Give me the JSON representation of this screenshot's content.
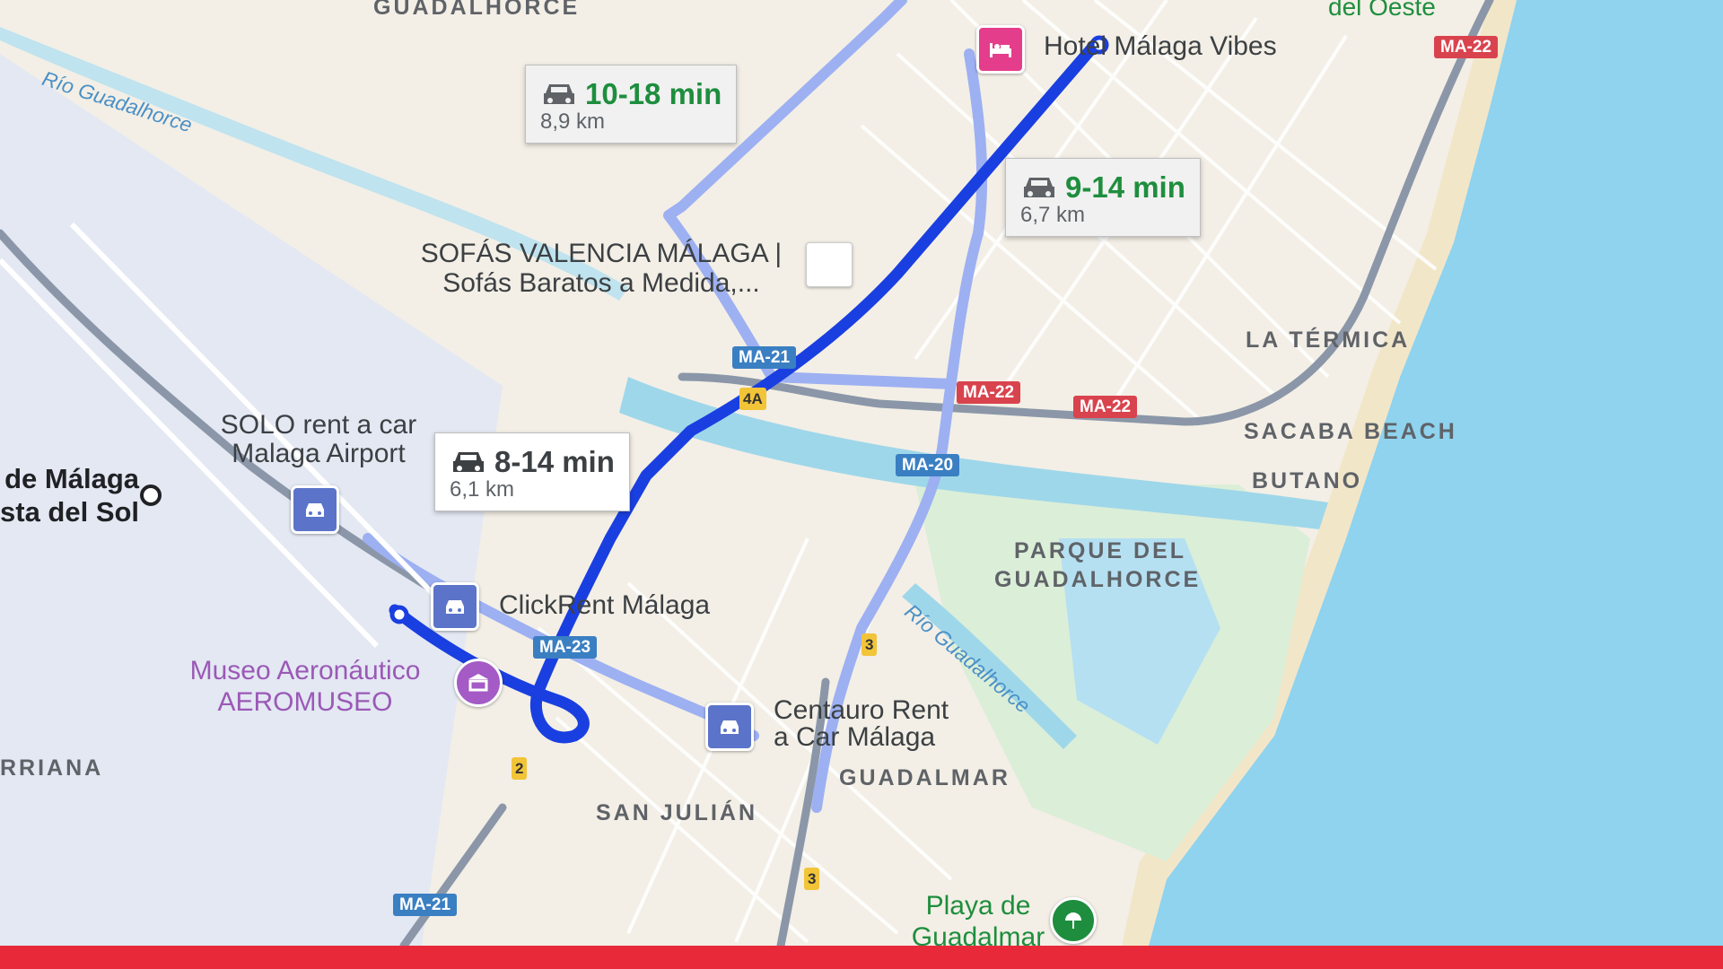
{
  "map": {
    "colors": {
      "sea": "#8fd3ee",
      "land": "#f3efe6",
      "airport": "#e3e8f3",
      "park": "#dbeed8",
      "river": "#9fd7ea",
      "route_primary": "#1a3fe0",
      "route_alt": "#9db0f2",
      "highway": "#8b97a8"
    },
    "areas": {
      "guadalhorce_top": "GUADALHORCE",
      "oeste_top": "del Oeste",
      "la_termica": "LA TÉRMICA",
      "sacaba_beach": "SACABA BEACH",
      "butano": "BUTANO",
      "parque_line1": "PARQUE DEL",
      "parque_line2": "GUADALHORCE",
      "guadalmar": "GUADALMAR",
      "san_julian": "SAN JULIÁN",
      "churriana": "RRIANA"
    },
    "water": {
      "river_top": "Río Guadalhorce",
      "river_mid": "Río Guadalhorce"
    },
    "places": {
      "hotel": "Hotel Málaga Vibes",
      "sofas_line1": "SOFÁS VALENCIA MÁLAGA |",
      "sofas_line2": "Sofás Baratos a Medida,...",
      "solo_line1": "SOLO rent a car",
      "solo_line2": "Malaga Airport",
      "airport_line1": "de Málaga",
      "airport_line2": "sta del Sol",
      "clickrent": "ClickRent Málaga",
      "museum_line1": "Museo Aeronáutico",
      "museum_line2": "AEROMUSEO",
      "centauro_line1": "Centauro Rent",
      "centauro_line2": "a Car Málaga",
      "playa_line1": "Playa de",
      "playa_line2": "Guadalmar"
    },
    "road_shields": {
      "ma22_top": "MA-22",
      "ma21_mid": "MA-21",
      "ma22_a": "MA-22",
      "ma22_b": "MA-22",
      "exit_4a": "4A",
      "ma20": "MA-20",
      "ma23": "MA-23",
      "exit_3a": "3",
      "exit_2": "2",
      "exit_3b": "3",
      "ma21_bottom": "MA-21"
    },
    "icons": {
      "car": "car-icon",
      "hotel": "bed-icon",
      "museum": "museum-icon",
      "beach": "beach-umbrella-icon",
      "rental": "car-rental-icon"
    }
  },
  "routes": [
    {
      "time": "8-14 min",
      "distance": "6,1 km",
      "selected": true
    },
    {
      "time": "10-18 min",
      "distance": "8,9 km",
      "selected": false
    },
    {
      "time": "9-14 min",
      "distance": "6,7 km",
      "selected": false
    }
  ]
}
